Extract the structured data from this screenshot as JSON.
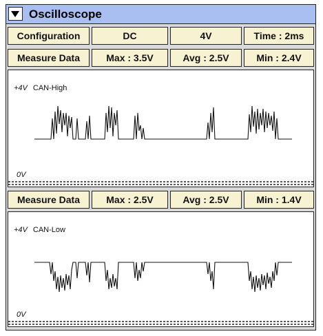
{
  "window": {
    "title": "Oscilloscope"
  },
  "config_row": {
    "label": "Configuration",
    "coupling": "DC",
    "volts_div": "4V",
    "time_div": "Time : 2ms"
  },
  "channel_high": {
    "measure_label": "Measure Data",
    "max": "Max : 3.5V",
    "avg": "Avg : 2.5V",
    "min": "Min : 2.4V",
    "top_label": "+4V",
    "signal_name": "CAN-High",
    "zero_label": "0V"
  },
  "channel_low": {
    "measure_label": "Measure Data",
    "max": "Max : 2.5V",
    "avg": "Avg : 2.5V",
    "min": "Min : 1.4V",
    "top_label": "+4V",
    "signal_name": "CAN-Low",
    "zero_label": "0V"
  },
  "colors": {
    "titlebar": "#a9bff2",
    "cell_bg": "#f7f2d2",
    "panel_bg": "#d9d9d9",
    "trace": "#111111"
  }
}
